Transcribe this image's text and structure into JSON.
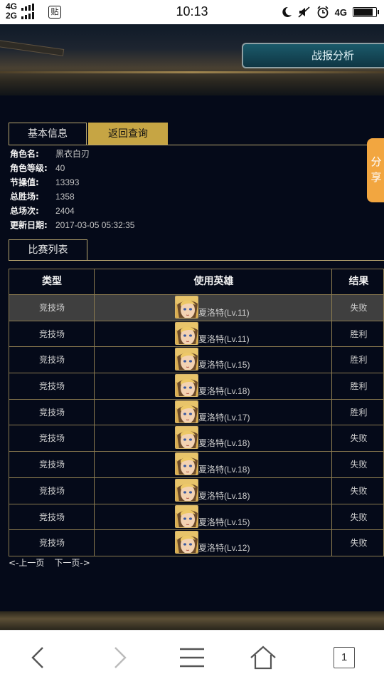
{
  "status_bar": {
    "network_top": "4G",
    "network_bottom": "2G",
    "app_badge": "贴",
    "time": "10:13",
    "right_network": "4G",
    "battery_level": 0.9
  },
  "header": {
    "analysis_tab": "战报分析"
  },
  "tabs": {
    "basic_info": "基本信息",
    "back_query": "返回查询"
  },
  "share_button": "分享",
  "info": [
    {
      "label": "角色名:",
      "value": "黑衣白刃"
    },
    {
      "label": "角色等级:",
      "value": "40"
    },
    {
      "label": "节操值:",
      "value": "13393"
    },
    {
      "label": "总胜场:",
      "value": "1358"
    },
    {
      "label": "总场次:",
      "value": "2404"
    },
    {
      "label": "更新日期:",
      "value": "2017-03-05 05:32:35"
    }
  ],
  "list_tab": "比赛列表",
  "table": {
    "headers": [
      "类型",
      "使用英雄",
      "结果"
    ],
    "rows": [
      {
        "type": "竞技场",
        "hero": "夏洛特(Lv.11)",
        "result": "失败"
      },
      {
        "type": "竞技场",
        "hero": "夏洛特(Lv.11)",
        "result": "胜利"
      },
      {
        "type": "竞技场",
        "hero": "夏洛特(Lv.15)",
        "result": "胜利"
      },
      {
        "type": "竞技场",
        "hero": "夏洛特(Lv.18)",
        "result": "胜利"
      },
      {
        "type": "竞技场",
        "hero": "夏洛特(Lv.17)",
        "result": "胜利"
      },
      {
        "type": "竞技场",
        "hero": "夏洛特(Lv.18)",
        "result": "失败"
      },
      {
        "type": "竞技场",
        "hero": "夏洛特(Lv.18)",
        "result": "失败"
      },
      {
        "type": "竞技场",
        "hero": "夏洛特(Lv.18)",
        "result": "失败"
      },
      {
        "type": "竞技场",
        "hero": "夏洛特(Lv.15)",
        "result": "失败"
      },
      {
        "type": "竞技场",
        "hero": "夏洛特(Lv.12)",
        "result": "失败"
      }
    ]
  },
  "pager": {
    "prev": "<-上一页",
    "next": "下一页->"
  },
  "browser_nav": {
    "tab_count": "1"
  }
}
